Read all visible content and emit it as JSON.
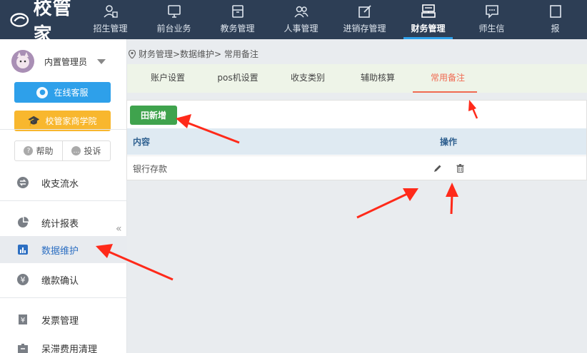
{
  "brand": {
    "name": "校管家"
  },
  "nav": {
    "items": [
      {
        "label": "招生管理",
        "icon": "user-clipboard-icon"
      },
      {
        "label": "前台业务",
        "icon": "monitor-icon"
      },
      {
        "label": "教务管理",
        "icon": "folder-icon"
      },
      {
        "label": "人事管理",
        "icon": "people-icon"
      },
      {
        "label": "进销存管理",
        "icon": "edit-box-icon"
      },
      {
        "label": "财务管理",
        "icon": "cash-register-icon",
        "active": true
      },
      {
        "label": "师生信",
        "icon": "chat-icon"
      },
      {
        "label": "报",
        "icon": "report-icon"
      }
    ]
  },
  "sidebar": {
    "user": {
      "name": "内置管理员"
    },
    "service_button": "在线客服",
    "academy_button": "校管家商学院",
    "help_label": "帮助",
    "complain_label": "投诉",
    "menu": [
      {
        "label": "收支流水",
        "icon": "transfer-icon"
      },
      {
        "label": "统计报表",
        "icon": "pie-chart-icon"
      },
      {
        "label": "数据维护",
        "icon": "bar-chart-icon",
        "active": true
      },
      {
        "label": "缴款确认",
        "icon": "yen-icon"
      },
      {
        "label": "发票管理",
        "icon": "invoice-icon"
      },
      {
        "label": "呆滞费用清理",
        "icon": "cleanup-icon"
      }
    ]
  },
  "breadcrumb": {
    "text": "财务管理>数据维护> 常用备注"
  },
  "tabs": [
    {
      "label": "账户设置"
    },
    {
      "label": "pos机设置"
    },
    {
      "label": "收支类别"
    },
    {
      "label": "辅助核算"
    },
    {
      "label": "常用备注",
      "active": true
    }
  ],
  "toolbar": {
    "add_label": "田新增"
  },
  "table": {
    "headers": {
      "content": "内容",
      "ops": "操作"
    },
    "rows": [
      {
        "content": "银行存款"
      }
    ]
  },
  "colors": {
    "nav_bg": "#2d3e55",
    "accent_blue": "#2ea0ea",
    "accent_orange": "#f8b72e",
    "tab_active": "#f06a52",
    "add_green": "#3fa34d",
    "annotation_red": "#ff2a1a"
  }
}
